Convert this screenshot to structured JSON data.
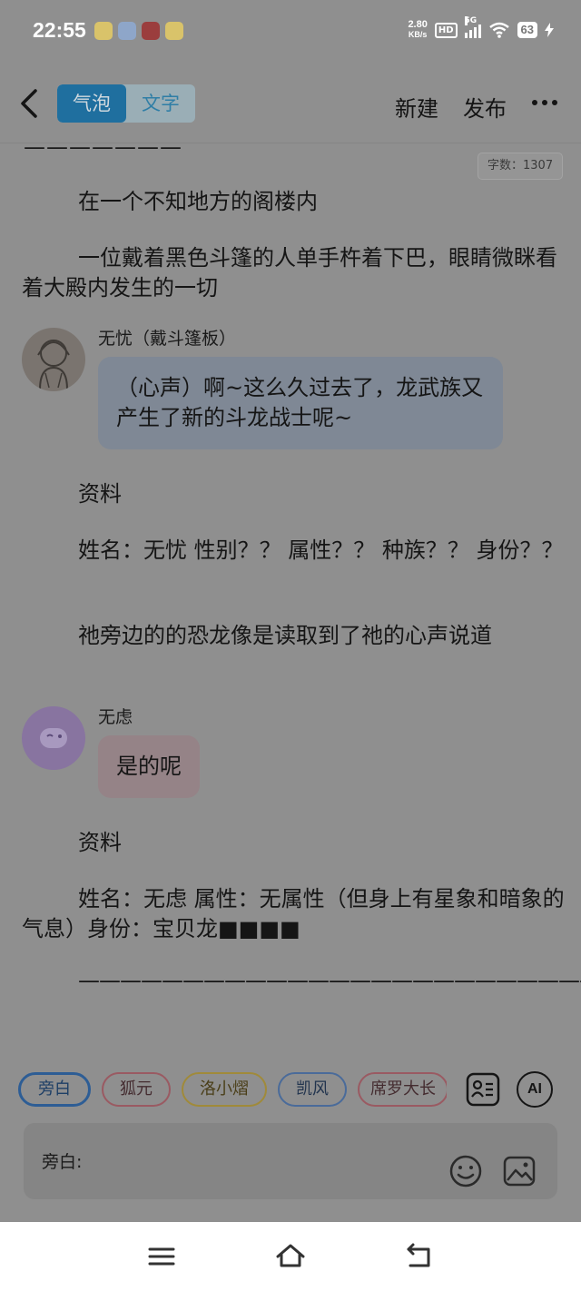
{
  "status_bar": {
    "time": "22:55",
    "net_speed_value": "2.80",
    "net_speed_unit": "KB/s",
    "hd_label": "HD",
    "signal_label": "5G",
    "battery": "63",
    "app_colors": [
      "#d9c36a",
      "#8ea6c9",
      "#9b3d3d",
      "#d9c36a"
    ]
  },
  "header": {
    "mode_bubble": "气泡",
    "mode_text": "文字",
    "new_label": "新建",
    "publish_label": "发布"
  },
  "content": {
    "top_dashes": "———————",
    "word_count": "字数：1307",
    "para1": "在一个不知地方的阁楼内",
    "para2": "一位戴着黑色斗篷的人单手杵着下巴，眼睛微眯看着大殿内发生的一切",
    "speaker1_name": "无忧（戴斗篷板）",
    "bubble1": "（心声）啊~这么久过去了，龙武族又产生了新的斗龙战士呢~",
    "para3": "资料",
    "para4": "姓名：无忧 性别？？ 属性？？ 种族？？ 身份？？",
    "para5": "祂旁边的的恐龙像是读取到了祂的心声说道",
    "speaker2_name": "无虑",
    "bubble2": "是的呢",
    "para6": "资料",
    "para7": "姓名：无虑 属性：无属性（但身上有星象和暗象的气息）身份：宝贝龙■■■■",
    "para8": "————————————————————————————————"
  },
  "chips": [
    {
      "label": "旁白"
    },
    {
      "label": "狐元"
    },
    {
      "label": "洛小熠"
    },
    {
      "label": "凯风"
    },
    {
      "label": "席罗大长"
    }
  ],
  "ai_label": "AI",
  "input": {
    "label": "旁白:"
  }
}
